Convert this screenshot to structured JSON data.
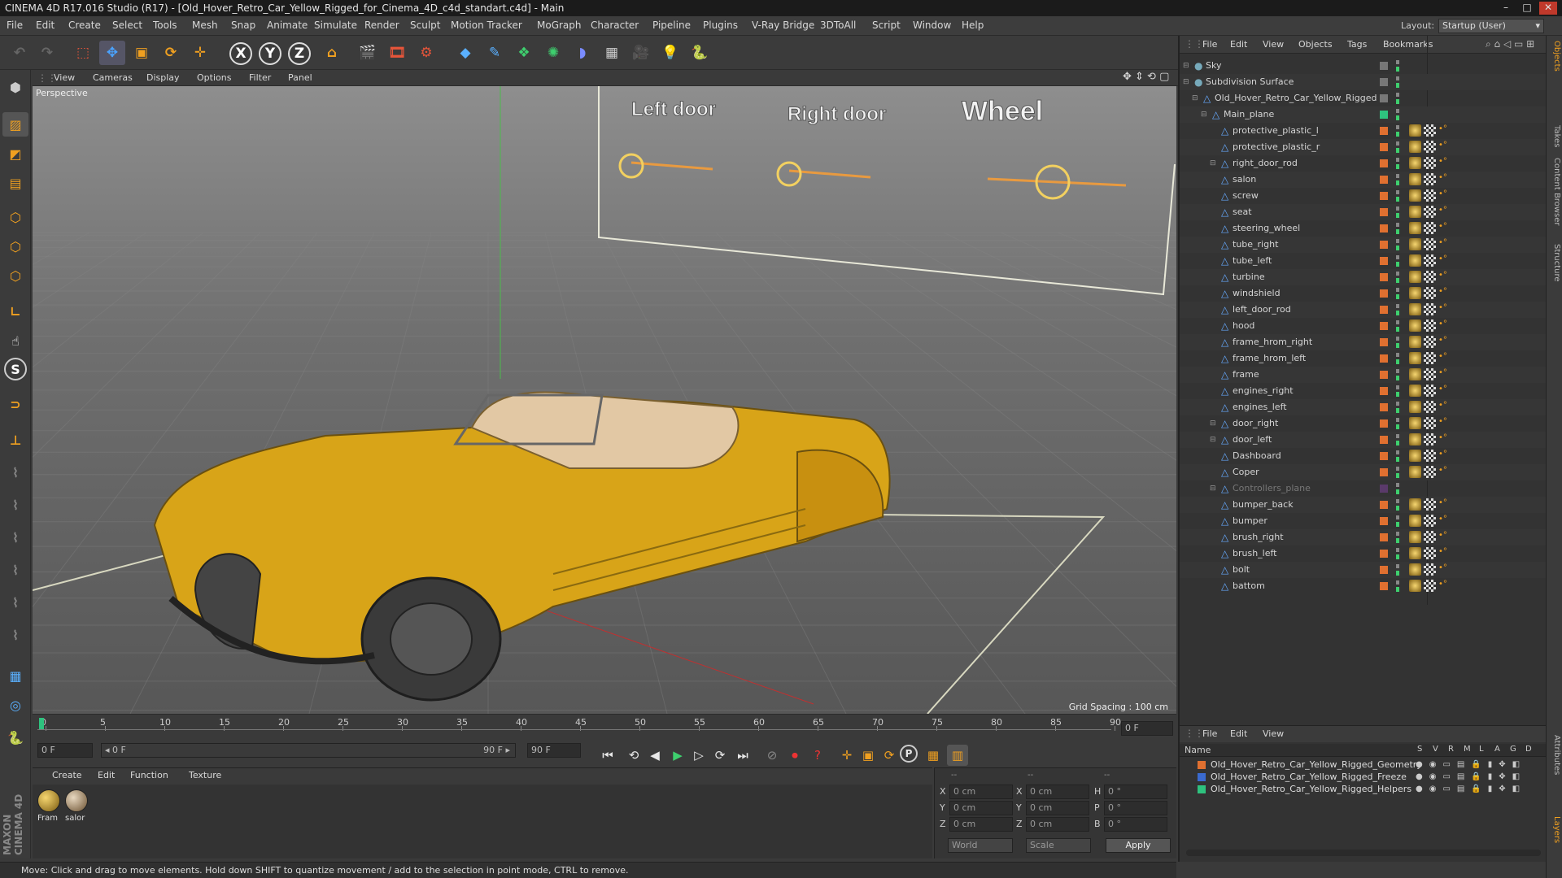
{
  "window": {
    "title": "CINEMA 4D R17.016 Studio (R17) - [Old_Hover_Retro_Car_Yellow_Rigged_for_Cinema_4D_c4d_standart.c4d] - Main",
    "min": "–",
    "max": "□",
    "close": "✕"
  },
  "menu": [
    "File",
    "Edit",
    "Create",
    "Select",
    "Tools",
    "Mesh",
    "Snap",
    "Animate",
    "Simulate",
    "Render",
    "Sculpt",
    "Motion Tracker",
    "MoGraph",
    "Character",
    "Pipeline",
    "Plugins",
    "V-Ray Bridge",
    "3DToAll",
    "Script",
    "Window",
    "Help"
  ],
  "layout": {
    "label": "Layout:",
    "value": "Startup (User)"
  },
  "toolbar": {
    "x": "X",
    "y": "Y",
    "z": "Z"
  },
  "lefttools": {
    "s": "S"
  },
  "viewport": {
    "menu": [
      "View",
      "Cameras",
      "Display",
      "Options",
      "Filter",
      "Panel"
    ],
    "label": "Perspective",
    "grid_spacing": "Grid Spacing : 100 cm",
    "controls": [
      "Left door",
      "Right door",
      "Wheel"
    ]
  },
  "timeline": {
    "ticks": [
      "0",
      "5",
      "10",
      "15",
      "20",
      "25",
      "30",
      "35",
      "40",
      "45",
      "50",
      "55",
      "60",
      "65",
      "70",
      "75",
      "80",
      "85",
      "90"
    ],
    "end_frame": "0 F"
  },
  "transport": {
    "current": "0 F",
    "range_start": "◂ 0 F",
    "range_end": "90 F ▸",
    "max": "90 F",
    "p": "P"
  },
  "materials": {
    "menu": [
      "Create",
      "Edit",
      "Function",
      "Texture"
    ],
    "items": [
      "Fram",
      "salor"
    ]
  },
  "coords": {
    "headers": [
      "--",
      "--",
      "--"
    ],
    "rows": [
      {
        "a": "X",
        "av": "0 cm",
        "b": "X",
        "bv": "0 cm",
        "c": "H",
        "cv": "0 °"
      },
      {
        "a": "Y",
        "av": "0 cm",
        "b": "Y",
        "bv": "0 cm",
        "c": "P",
        "cv": "0 °"
      },
      {
        "a": "Z",
        "av": "0 cm",
        "b": "Z",
        "bv": "0 cm",
        "c": "B",
        "cv": "0 °"
      }
    ],
    "world": "World",
    "scale": "Scale",
    "apply": "Apply"
  },
  "status": "Move: Click and drag to move elements. Hold down SHIFT to quantize movement / add to the selection in point mode, CTRL to remove.",
  "objects": {
    "menu": [
      "File",
      "Edit",
      "View",
      "Objects",
      "Tags",
      "Bookmarks"
    ],
    "items": [
      {
        "name": "Sky",
        "indent": 0,
        "color": "#777"
      },
      {
        "name": "Subdivision Surface",
        "indent": 0,
        "color": "#777"
      },
      {
        "name": "Old_Hover_Retro_Car_Yellow_Rigged",
        "indent": 1,
        "color": "#777"
      },
      {
        "name": "Main_plane",
        "indent": 2,
        "color": "#2ec27e"
      },
      {
        "name": "protective_plastic_l",
        "indent": 3,
        "color": "#e07030"
      },
      {
        "name": "protective_plastic_r",
        "indent": 3,
        "color": "#e07030"
      },
      {
        "name": "right_door_rod",
        "indent": 3,
        "color": "#e07030"
      },
      {
        "name": "salon",
        "indent": 3,
        "color": "#e07030"
      },
      {
        "name": "screw",
        "indent": 3,
        "color": "#e07030"
      },
      {
        "name": "seat",
        "indent": 3,
        "color": "#e07030"
      },
      {
        "name": "steering_wheel",
        "indent": 3,
        "color": "#e07030"
      },
      {
        "name": "tube_right",
        "indent": 3,
        "color": "#e07030"
      },
      {
        "name": "tube_left",
        "indent": 3,
        "color": "#e07030"
      },
      {
        "name": "turbine",
        "indent": 3,
        "color": "#e07030"
      },
      {
        "name": "windshield",
        "indent": 3,
        "color": "#e07030"
      },
      {
        "name": "left_door_rod",
        "indent": 3,
        "color": "#e07030"
      },
      {
        "name": "hood",
        "indent": 3,
        "color": "#e07030"
      },
      {
        "name": "frame_hrom_right",
        "indent": 3,
        "color": "#e07030"
      },
      {
        "name": "frame_hrom_left",
        "indent": 3,
        "color": "#e07030"
      },
      {
        "name": "frame",
        "indent": 3,
        "color": "#e07030"
      },
      {
        "name": "engines_right",
        "indent": 3,
        "color": "#e07030"
      },
      {
        "name": "engines_left",
        "indent": 3,
        "color": "#e07030"
      },
      {
        "name": "door_right",
        "indent": 3,
        "color": "#e07030"
      },
      {
        "name": "door_left",
        "indent": 3,
        "color": "#e07030"
      },
      {
        "name": "Dashboard",
        "indent": 3,
        "color": "#e07030"
      },
      {
        "name": "Coper",
        "indent": 3,
        "color": "#e07030"
      },
      {
        "name": "Controllers_plane",
        "indent": 3,
        "color": "#5a3a6a"
      },
      {
        "name": "bumper_back",
        "indent": 3,
        "color": "#e07030"
      },
      {
        "name": "bumper",
        "indent": 3,
        "color": "#e07030"
      },
      {
        "name": "brush_right",
        "indent": 3,
        "color": "#e07030"
      },
      {
        "name": "brush_left",
        "indent": 3,
        "color": "#e07030"
      },
      {
        "name": "bolt",
        "indent": 3,
        "color": "#e07030"
      },
      {
        "name": "battom",
        "indent": 3,
        "color": "#e07030"
      }
    ]
  },
  "layers": {
    "menu": [
      "File",
      "Edit",
      "View"
    ],
    "header": {
      "name": "Name",
      "cols": [
        "S",
        "V",
        "R",
        "M",
        "L",
        "A",
        "G",
        "D"
      ]
    },
    "items": [
      {
        "name": "Old_Hover_Retro_Car_Yellow_Rigged_Geometry",
        "color": "#e07030"
      },
      {
        "name": "Old_Hover_Retro_Car_Yellow_Rigged_Freeze",
        "color": "#3a6ad0"
      },
      {
        "name": "Old_Hover_Retro_Car_Yellow_Rigged_Helpers",
        "color": "#2ec27e"
      }
    ]
  },
  "side_tabs": [
    "Objects",
    "Takes",
    "Content Browser",
    "Structure",
    "Attributes",
    "Layers"
  ],
  "brand": "MAXON CINEMA 4D"
}
